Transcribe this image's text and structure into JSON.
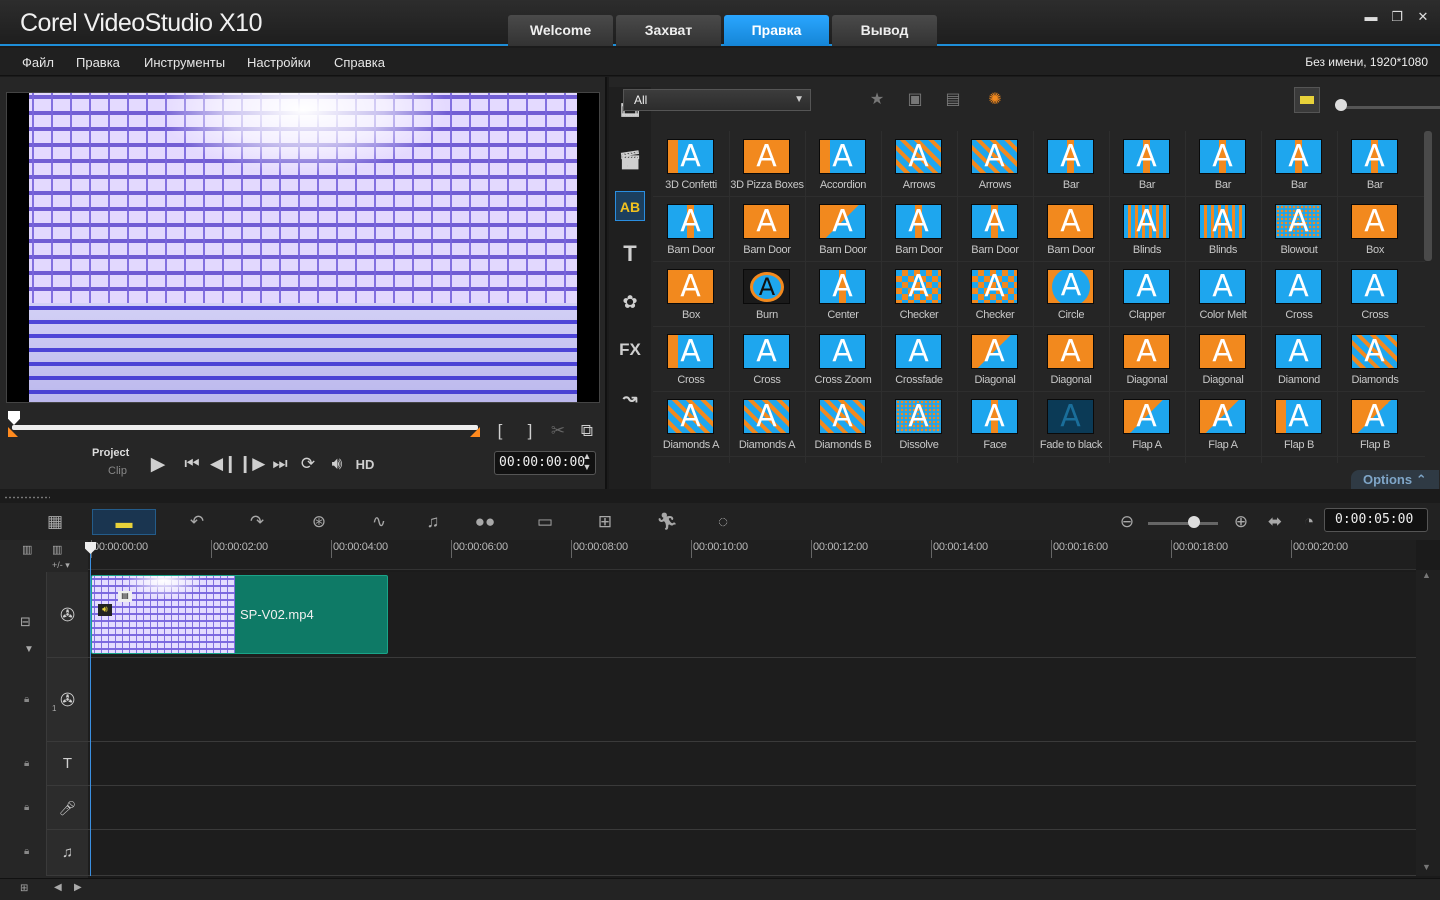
{
  "app": {
    "logo": "Corel VideoStudio X10",
    "tabs": [
      {
        "label": "Welcome",
        "active": false
      },
      {
        "label": "Захват",
        "active": false
      },
      {
        "label": "Правка",
        "active": true
      },
      {
        "label": "Вывод",
        "active": false
      }
    ],
    "window_controls": [
      "▬",
      "❐",
      "✕"
    ]
  },
  "menu": {
    "items": [
      "Файл",
      "Правка",
      "Инструменты",
      "Настройки",
      "Справка"
    ],
    "project_info": "Без имени, 1920*1080"
  },
  "preview": {
    "project_label": "Project",
    "clip_label": "Clip",
    "timecode": "00:00:00:00",
    "hd_label": "HD",
    "mark_in": "[",
    "mark_out": "]"
  },
  "library": {
    "filter": "All",
    "sidebar_active": "transition",
    "fx_label": "FX",
    "options_label": "Options",
    "transitions": [
      {
        "label": "3D Confetti",
        "style": "half"
      },
      {
        "label": "3D Pizza Boxes",
        "style": "orange"
      },
      {
        "label": "Accordion",
        "style": "half"
      },
      {
        "label": "Arrows",
        "style": "dia"
      },
      {
        "label": "Arrows",
        "style": "dia"
      },
      {
        "label": "Bar",
        "style": "split"
      },
      {
        "label": "Bar",
        "style": "split"
      },
      {
        "label": "Bar",
        "style": "split"
      },
      {
        "label": "Bar",
        "style": "split"
      },
      {
        "label": "Bar",
        "style": "split"
      },
      {
        "label": "Barn Door",
        "style": "split"
      },
      {
        "label": "Barn Door",
        "style": "orange"
      },
      {
        "label": "Barn Door",
        "style": "diag"
      },
      {
        "label": "Barn Door",
        "style": "split"
      },
      {
        "label": "Barn Door",
        "style": "split"
      },
      {
        "label": "Barn Door",
        "style": "orange"
      },
      {
        "label": "Blinds",
        "style": "stripes"
      },
      {
        "label": "Blinds",
        "style": "stripes"
      },
      {
        "label": "Blowout",
        "style": "dotted"
      },
      {
        "label": "Box",
        "style": "orange"
      },
      {
        "label": "Box",
        "style": "orange"
      },
      {
        "label": "Burn",
        "style": "burn"
      },
      {
        "label": "Center",
        "style": "split"
      },
      {
        "label": "Checker",
        "style": "check"
      },
      {
        "label": "Checker",
        "style": "check"
      },
      {
        "label": "Circle",
        "style": "circle"
      },
      {
        "label": "Clapper",
        "style": "blue"
      },
      {
        "label": "Color Melt",
        "style": "blue"
      },
      {
        "label": "Cross",
        "style": "blue"
      },
      {
        "label": "Cross",
        "style": "blue"
      },
      {
        "label": "Cross",
        "style": "half"
      },
      {
        "label": "Cross",
        "style": "blue"
      },
      {
        "label": "Cross Zoom",
        "style": "blue"
      },
      {
        "label": "Crossfade",
        "style": "blue"
      },
      {
        "label": "Diagonal",
        "style": "diag"
      },
      {
        "label": "Diagonal",
        "style": "orange"
      },
      {
        "label": "Diagonal",
        "style": "orange"
      },
      {
        "label": "Diagonal",
        "style": "orange"
      },
      {
        "label": "Diamond",
        "style": "blue"
      },
      {
        "label": "Diamonds",
        "style": "dia"
      },
      {
        "label": "Diamonds A",
        "style": "dia"
      },
      {
        "label": "Diamonds A",
        "style": "dia"
      },
      {
        "label": "Diamonds B",
        "style": "dia"
      },
      {
        "label": "Dissolve",
        "style": "dotted"
      },
      {
        "label": "Face",
        "style": "split"
      },
      {
        "label": "Fade to black",
        "style": "dark"
      },
      {
        "label": "Flap A",
        "style": "diag"
      },
      {
        "label": "Flap A",
        "style": "diag"
      },
      {
        "label": "Flap B",
        "style": "half"
      },
      {
        "label": "Flap B",
        "style": "diag"
      }
    ]
  },
  "timeline": {
    "duration": "0:00:05:00",
    "ruler": [
      "00:00:00:00",
      "00:00:02:00",
      "00:00:04:00",
      "00:00:06:00",
      "00:00:08:00",
      "00:00:10:00",
      "00:00:12:00",
      "00:00:14:00",
      "00:00:16:00",
      "00:00:18:00",
      "00:00:20:00"
    ],
    "clip_name": "SP-V02.mp4",
    "track_overlay_index": "1",
    "colors": {
      "accent": "#1e8ed8",
      "clip": "#0e7a66"
    }
  }
}
